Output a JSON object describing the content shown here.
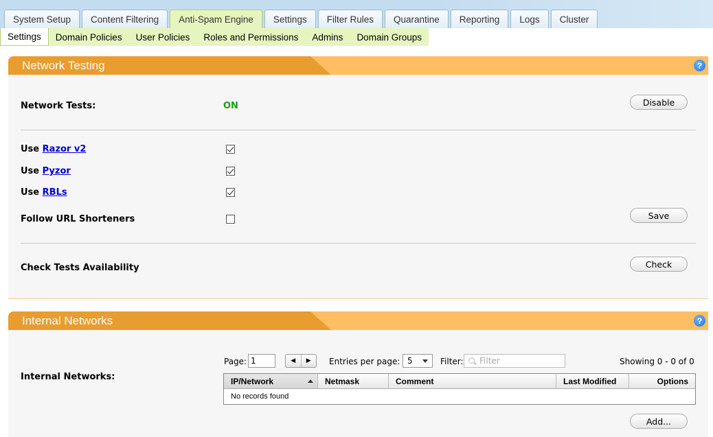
{
  "top_tabs": [
    {
      "label": "System Setup",
      "active": false
    },
    {
      "label": "Content Filtering",
      "active": false
    },
    {
      "label": "Anti-Spam Engine",
      "active": true
    },
    {
      "label": "Settings",
      "active": false
    },
    {
      "label": "Filter Rules",
      "active": false
    },
    {
      "label": "Quarantine",
      "active": false
    },
    {
      "label": "Reporting",
      "active": false
    },
    {
      "label": "Logs",
      "active": false
    },
    {
      "label": "Cluster",
      "active": false
    }
  ],
  "sub_nav": [
    {
      "label": "Settings",
      "active": true
    },
    {
      "label": "Domain Policies",
      "active": false
    },
    {
      "label": "User Policies",
      "active": false
    },
    {
      "label": "Roles and Permissions",
      "active": false
    },
    {
      "label": "Admins",
      "active": false
    },
    {
      "label": "Domain Groups",
      "active": false
    }
  ],
  "network_testing": {
    "title": "Network Testing",
    "help": "?",
    "network_tests_label": "Network Tests:",
    "network_tests_status": "ON",
    "disable_button": "Disable",
    "use_prefix": "Use",
    "razor_link": "Razor v2",
    "razor_checked": true,
    "pyzor_link": "Pyzor",
    "pyzor_checked": true,
    "rbls_link": "RBLs",
    "rbls_checked": true,
    "follow_url_label": "Follow URL Shorteners",
    "follow_url_checked": false,
    "save_button": "Save",
    "check_label": "Check Tests Availability",
    "check_button": "Check"
  },
  "internal_networks": {
    "title": "Internal Networks",
    "help": "?",
    "label": "Internal Networks:",
    "page_label": "Page:",
    "page_value": "1",
    "entries_label": "Entries per page:",
    "entries_value": "5",
    "filter_label": "Filter:",
    "filter_placeholder": "Filter",
    "showing": "Showing 0 - 0 of 0",
    "columns": [
      "IP/Network",
      "Netmask",
      "Comment",
      "Last Modified",
      "Options"
    ],
    "empty_text": "No records found",
    "add_button": "Add..."
  },
  "colors": {
    "header_dark": "#e99c2f",
    "header_light": "#ffbe62",
    "status_on": "#1a9e1a",
    "link": "#0000cc",
    "active_tab": "#e6f5c0"
  }
}
